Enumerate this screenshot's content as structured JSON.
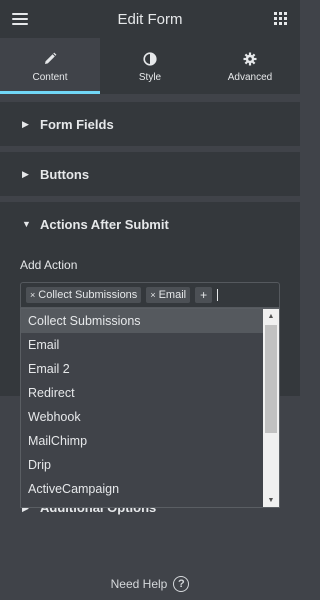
{
  "header": {
    "title": "Edit Form",
    "menu_icon": "hamburger-menu-icon",
    "apps_icon": "grid-apps-icon"
  },
  "tabs": [
    {
      "label": "Content",
      "icon": "pencil-icon",
      "active": true
    },
    {
      "label": "Style",
      "icon": "half-circle-icon",
      "active": false
    },
    {
      "label": "Advanced",
      "icon": "gear-icon",
      "active": false
    }
  ],
  "sections": {
    "form_fields": "Form Fields",
    "buttons": "Buttons",
    "actions_after_submit": "Actions After Submit",
    "additional_options": "Additional Options"
  },
  "actions": {
    "label": "Add Action",
    "selected": [
      "Collect Submissions",
      "Email"
    ],
    "remove_symbol": "×",
    "add_symbol": "+",
    "options": [
      "Collect Submissions",
      "Email",
      "Email 2",
      "Redirect",
      "Webhook",
      "MailChimp",
      "Drip",
      "ActiveCampaign"
    ],
    "highlighted_index": 0
  },
  "footer": {
    "need_help": "Need Help",
    "help_icon": "question-circle-icon",
    "help_glyph": "?"
  },
  "colors": {
    "accent": "#71d7f7",
    "panel_bg": "#404349",
    "section_bg": "#34383c"
  }
}
